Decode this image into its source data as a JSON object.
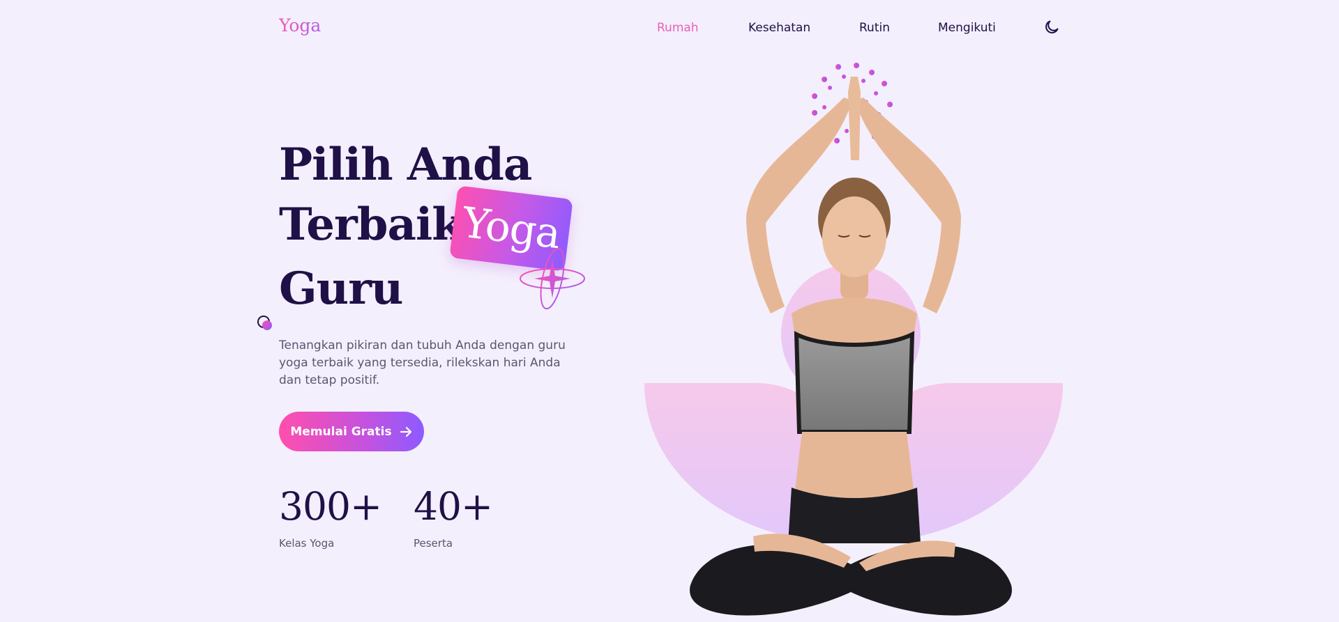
{
  "brand": {
    "logo": "Yoga"
  },
  "nav": {
    "items": [
      {
        "label": "Rumah",
        "active": true
      },
      {
        "label": "Kesehatan",
        "active": false
      },
      {
        "label": "Rutin",
        "active": false
      },
      {
        "label": "Mengikuti",
        "active": false
      }
    ],
    "theme_toggle_icon": "moon-icon"
  },
  "hero": {
    "title_line1": "Pilih Anda",
    "title_line2": "Terbaik",
    "title_highlight": "Yoga",
    "title_line3": "Guru",
    "description": "Tenangkan pikiran dan tubuh Anda dengan guru yoga terbaik yang tersedia, rilekskan hari Anda dan tetap positif.",
    "cta_label": "Memulai Gratis",
    "cta_icon": "arrow-right-icon"
  },
  "stats": [
    {
      "value": "300+",
      "label": "Kelas Yoga"
    },
    {
      "value": "40+",
      "label": "Peserta"
    }
  ],
  "colors": {
    "background": "#f4effc",
    "text_dark": "#1f1147",
    "accent_pink": "#ff4fad",
    "accent_purple": "#8d5bff",
    "nav_active": "#e861b8"
  }
}
